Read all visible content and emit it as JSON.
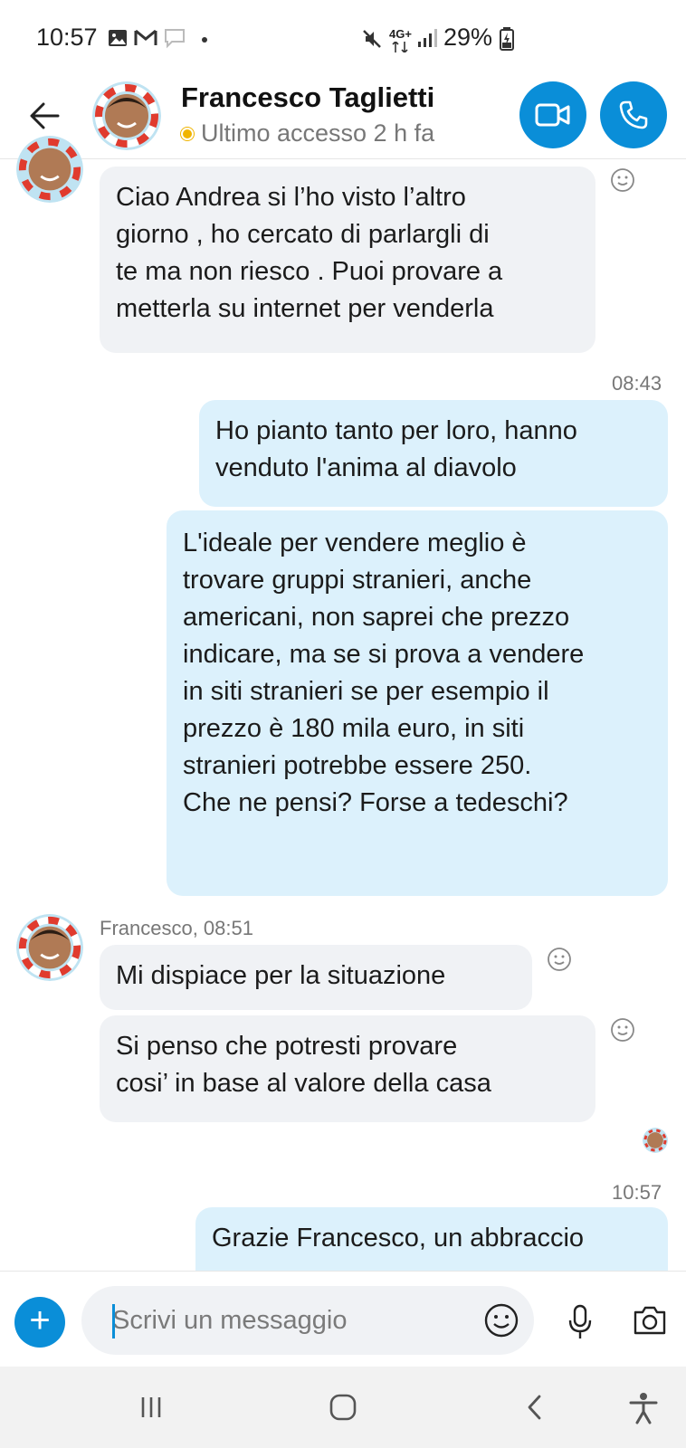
{
  "status_bar": {
    "time": "10:57",
    "network": "4G+",
    "battery": "29%"
  },
  "header": {
    "contact_name": "Francesco Taglietti",
    "presence": "Ultimo accesso 2 h fa"
  },
  "messages": [
    {
      "direction": "in",
      "text_lines": [
        "Ciao Andrea si l’ho visto l’altro",
        "giorno , ho cercato di parlargli di",
        "te ma non riesco . Puoi provare a",
        "metterla su internet per venderla"
      ]
    },
    {
      "timestamp": "08:43"
    },
    {
      "direction": "out",
      "text_lines": [
        "Ho pianto tanto per loro, hanno",
        "venduto l'anima al diavolo"
      ]
    },
    {
      "direction": "out",
      "text_lines": [
        "L'ideale per vendere meglio è",
        "trovare gruppi stranieri, anche",
        "americani, non saprei che prezzo",
        "indicare, ma se si prova a vendere",
        "in siti stranieri se per esempio il",
        "prezzo è 180 mila euro, in siti",
        "stranieri potrebbe essere 250.",
        "Che ne pensi? Forse a tedeschi?"
      ]
    },
    {
      "sender_line": "Francesco, 08:51"
    },
    {
      "direction": "in",
      "text_lines": [
        "Mi dispiace per la situazione"
      ]
    },
    {
      "direction": "in",
      "text_lines": [
        "Si penso che potresti provare",
        "cosi’ in base al valore della casa"
      ]
    },
    {
      "timestamp": "10:57"
    },
    {
      "direction": "out",
      "text_lines": [
        "Grazie Francesco, un abbraccio"
      ]
    }
  ],
  "composer": {
    "placeholder": "Scrivi un messaggio"
  },
  "colors": {
    "accent": "#0a8ed8",
    "incoming_bubble": "#f0f2f5",
    "outgoing_bubble": "#dcf1fc",
    "presence_away": "#f0b400"
  },
  "icons": {
    "back": "arrow-left-icon",
    "video": "video-camera-icon",
    "call": "phone-icon",
    "reaction": "smiley-icon",
    "add": "plus-icon",
    "emoji": "emoji-icon",
    "mic": "microphone-icon",
    "camera": "camera-icon"
  }
}
